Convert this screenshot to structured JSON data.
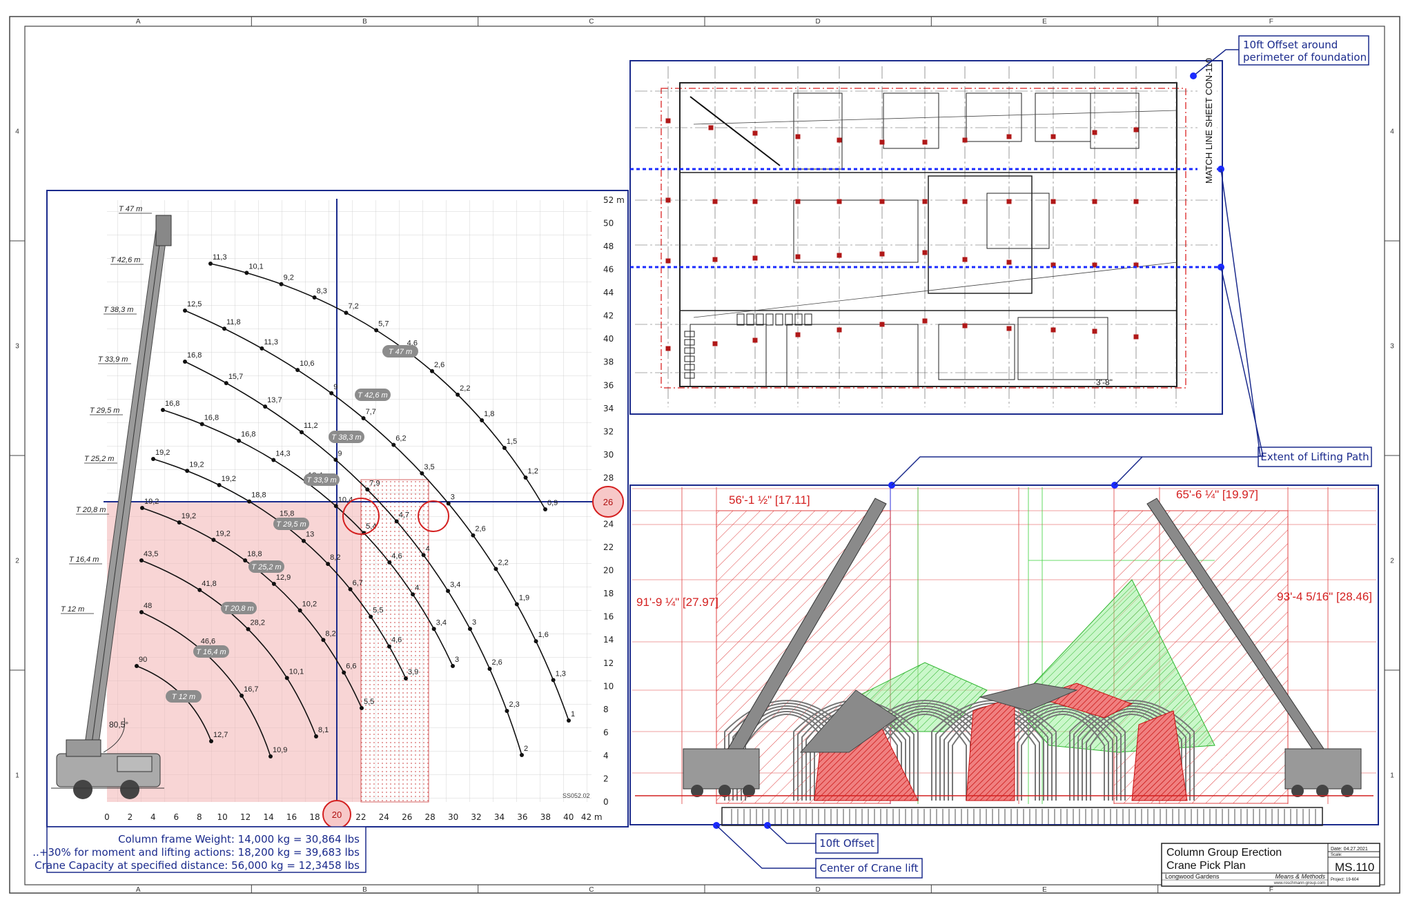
{
  "border": {
    "columns": [
      "A",
      "B",
      "C",
      "D",
      "E",
      "F"
    ],
    "rows": [
      "4",
      "3",
      "2",
      "1"
    ]
  },
  "load_chart": {
    "y_ticks": [
      "52 m",
      "50",
      "48",
      "46",
      "44",
      "42",
      "40",
      "38",
      "36",
      "34",
      "32",
      "30",
      "28",
      "26",
      "24",
      "22",
      "20",
      "18",
      "16",
      "14",
      "12",
      "10",
      "8",
      "6",
      "4",
      "2",
      "0"
    ],
    "x_ticks": [
      "0",
      "2",
      "4",
      "6",
      "8",
      "10",
      "12",
      "14",
      "16",
      "18",
      "20",
      "22",
      "24",
      "26",
      "28",
      "30",
      "32",
      "34",
      "36",
      "38",
      "40",
      "42 m"
    ],
    "boom_lengths": [
      "T 47 m",
      "T 42,6 m",
      "T 38,3 m",
      "T 33,9 m",
      "T 29,5 m",
      "T 25,2 m",
      "T 20,8 m",
      "T 16,4 m",
      "T 12 m"
    ],
    "pill_labels": [
      "T 47 m",
      "T 42,6 m",
      "T 38,3 m",
      "T 33,9 m",
      "T 29,5 m",
      "T 25,2 m",
      "T 20,8 m",
      "T 16,4 m",
      "T 12 m"
    ],
    "angle_label": "80,5°",
    "ref_code": "SS052.02",
    "highlight_x": "20",
    "highlight_y": "26",
    "capacities": [
      [
        "11,3",
        "10,1",
        "9,2",
        "8,3",
        "7,2",
        "5,7",
        "4,6",
        "2,6",
        "2,2",
        "1,8",
        "1,5",
        "1,2",
        "0,9"
      ],
      [
        "12,5",
        "11,8",
        "11,3",
        "10,6",
        "9",
        "7,7",
        "6,2",
        "3,5",
        "3",
        "2,6",
        "2,2",
        "1,9",
        "1,6",
        "1,3",
        "1"
      ],
      [
        "16,8",
        "15,7",
        "13,7",
        "11,2",
        "9",
        "7,9",
        "4,7",
        "4",
        "3,4",
        "3",
        "2,6",
        "2,3",
        "2"
      ],
      [
        "16,8",
        "16,8",
        "16,8",
        "14,3",
        "12,4",
        "10,4",
        "5,4",
        "4,6",
        "4",
        "3,4",
        "3"
      ],
      [
        "19,2",
        "19,2",
        "19,2",
        "18,8",
        "15,8",
        "13",
        "8,2",
        "6,7",
        "5,5",
        "4,6",
        "3,9"
      ],
      [
        "19,2",
        "19,2",
        "19,2",
        "18,8",
        "12,9",
        "10,2",
        "8,2",
        "6,6",
        "5,5"
      ],
      [
        "43,5",
        "41,8",
        "28,2",
        "10,1",
        "8,1"
      ],
      [
        "48",
        "46,6",
        "16,7",
        "10,9"
      ],
      [
        "90",
        "12,7"
      ]
    ]
  },
  "notes": {
    "line1": "Column frame Weight: 14,000 kg = 30,864 lbs",
    "line2": "..+30% for moment and lifting actions: 18,200 kg = 39,683 lbs",
    "line3": "Crane Capacity at specified distance: 56,000 kg = 12,3458 lbs"
  },
  "callouts": {
    "offset_perimeter": "10ft Offset around perimeter of foundation",
    "lifting_path": "Extent of Lifting Path",
    "offset": "10ft Offset",
    "center": "Center of Crane lift"
  },
  "plan": {
    "match_line": "MATCH LINE SHEET CON-110",
    "dim": "3'-8\""
  },
  "elevation": {
    "dim_left_top": "56'-1 ½\" [17.11]",
    "dim_right_top": "65'-6 ¼\" [19.97]",
    "dim_left_side": "91'-9 ¼\" [27.97]",
    "dim_right_side": "93'-4 5/16\" [28.46]"
  },
  "title_block": {
    "title": "Column Group Erection",
    "subtitle": "Crane Pick Plan",
    "client": "Longwood Gardens",
    "firm": "Means & Methods",
    "website": "www.roschmann-group.com",
    "date": "Date: 04.27.2021",
    "scale_label": "Scale:",
    "sheet": "MS.110",
    "project": "Project: 19-604"
  },
  "colors": {
    "blue": "#1a2a8c",
    "red": "#d42020",
    "pink": "#f7c8c8",
    "green": "#3ad03a"
  }
}
